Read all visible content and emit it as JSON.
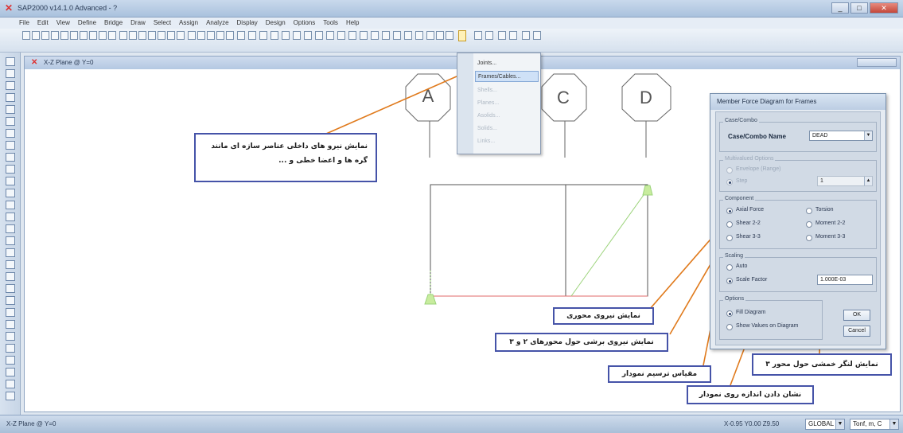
{
  "window": {
    "app_title": "SAP2000 v14.1.0 Advanced - ?",
    "controls": [
      "_",
      "□",
      "✕"
    ]
  },
  "menu": [
    "File",
    "Edit",
    "View",
    "Define",
    "Bridge",
    "Draw",
    "Select",
    "Assign",
    "Analyze",
    "Display",
    "Design",
    "Options",
    "Tools",
    "Help"
  ],
  "view": {
    "title": "X-Z Plane @ Y=0",
    "grid_labels": [
      "A",
      "C",
      "D"
    ]
  },
  "display_menu": {
    "items": [
      {
        "label": "Joints..."
      },
      {
        "label": "Frames/Cables..."
      },
      {
        "label": "Shells..."
      },
      {
        "label": "Planes..."
      },
      {
        "label": "Asolids..."
      },
      {
        "label": "Solids..."
      },
      {
        "label": "Links..."
      }
    ]
  },
  "dialog": {
    "title": "Member Force Diagram for Frames",
    "case_group": "Case/Combo",
    "case_label": "Case/Combo Name",
    "case_value": "DEAD",
    "multivalued_group": "Multivalued Options",
    "envelope_label": "Envelope (Range)",
    "step_label": "Step",
    "step_value": "1",
    "component_group": "Component",
    "axial_label": "Axial Force",
    "torsion_label": "Torsion",
    "shear22_label": "Shear 2-2",
    "moment22_label": "Moment 2-2",
    "shear33_label": "Shear 3-3",
    "moment33_label": "Moment 3-3",
    "scaling_group": "Scaling",
    "auto_label": "Auto",
    "scale_factor_label": "Scale Factor",
    "scale_value": "1.000E-03",
    "options_group": "Options",
    "fill_label": "Fill Diagram",
    "show_values_label": "Show Values on Diagram",
    "ok_label": "OK",
    "cancel_label": "Cancel"
  },
  "status": {
    "left": "X-Z Plane @ Y=0",
    "coords": "X-0.95  Y0.00  Z9.50",
    "coord_system": "GLOBAL",
    "units": "Tonf, m, C"
  },
  "callouts": {
    "internal_forces": "نمایش نیرو های داخلی  عناصر سازه ای مانند گره ها و اعضا خطی و ...",
    "axial": "نمایش نیروی محوری",
    "shear": "نمایش نیروی برشی حول محورهای ۲ و ۳",
    "scale": "مقیاس ترسیم نمودار",
    "values": "نشان دادن اندازه روی نمودار",
    "moment": "نمایش لنگر خمشی حول محور ۳"
  },
  "colors": {
    "callout_border": "#4553a8",
    "arrow": "#e07a1c",
    "diagram_green": "#9bd37a",
    "frame_red": "#e06a6a"
  }
}
